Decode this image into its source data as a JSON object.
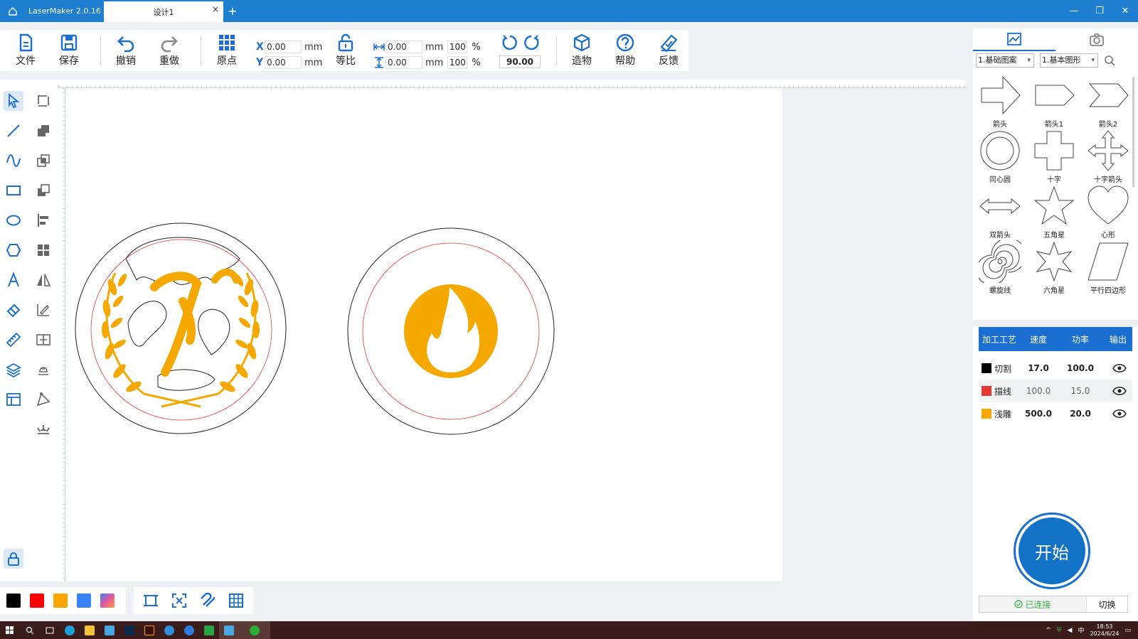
{
  "titlebar": {
    "app_name": "LaserMaker 2.0.16",
    "doc_tab": "设计1",
    "close_tab": "×",
    "new_tab": "+",
    "minimize": "—",
    "restore": "❐",
    "close": "✕"
  },
  "toolbar": {
    "file": "文件",
    "save": "保存",
    "undo": "撤销",
    "redo": "重做",
    "origin": "原点",
    "x_label": "X",
    "x_value": "0.00",
    "y_label": "Y",
    "y_value": "0.00",
    "unit": "mm",
    "lock_ratio": "等比",
    "width_value": "0.00",
    "height_value": "0.00",
    "width_pct": "100",
    "height_pct": "100",
    "pct_sign": "%",
    "angle": "90.00",
    "build": "造物",
    "help": "帮助",
    "feedback": "反馈"
  },
  "library": {
    "category": "1.基础图案",
    "subcategory": "1.基本图形",
    "shapes": [
      "箭头",
      "箭头1",
      "箭头2",
      "同心圆",
      "十字",
      "十字箭头",
      "双箭头",
      "五角星",
      "心形",
      "螺旋线",
      "六角星",
      "平行四边形"
    ]
  },
  "layers": {
    "headers": [
      "加工工艺",
      "速度",
      "功率",
      "输出"
    ],
    "rows": [
      {
        "name": "切割",
        "speed": "17.0",
        "power": "100.0",
        "color": "#000000"
      },
      {
        "name": "描线",
        "speed": "100.0",
        "power": "15.0",
        "color": "#e53935"
      },
      {
        "name": "浅雕",
        "speed": "500.0",
        "power": "20.0",
        "color": "#f5a800"
      }
    ]
  },
  "start_button": "开始",
  "connection": {
    "status": "已连接",
    "switch": "切换"
  },
  "palette": [
    "#000000",
    "#ff0000",
    "#ffa500",
    "#3b82f6",
    "#e4579c"
  ],
  "accent_color": "#1b6fd0",
  "taskbar": {
    "time": "18:53",
    "date": "2024/6/24",
    "ime": "中"
  }
}
